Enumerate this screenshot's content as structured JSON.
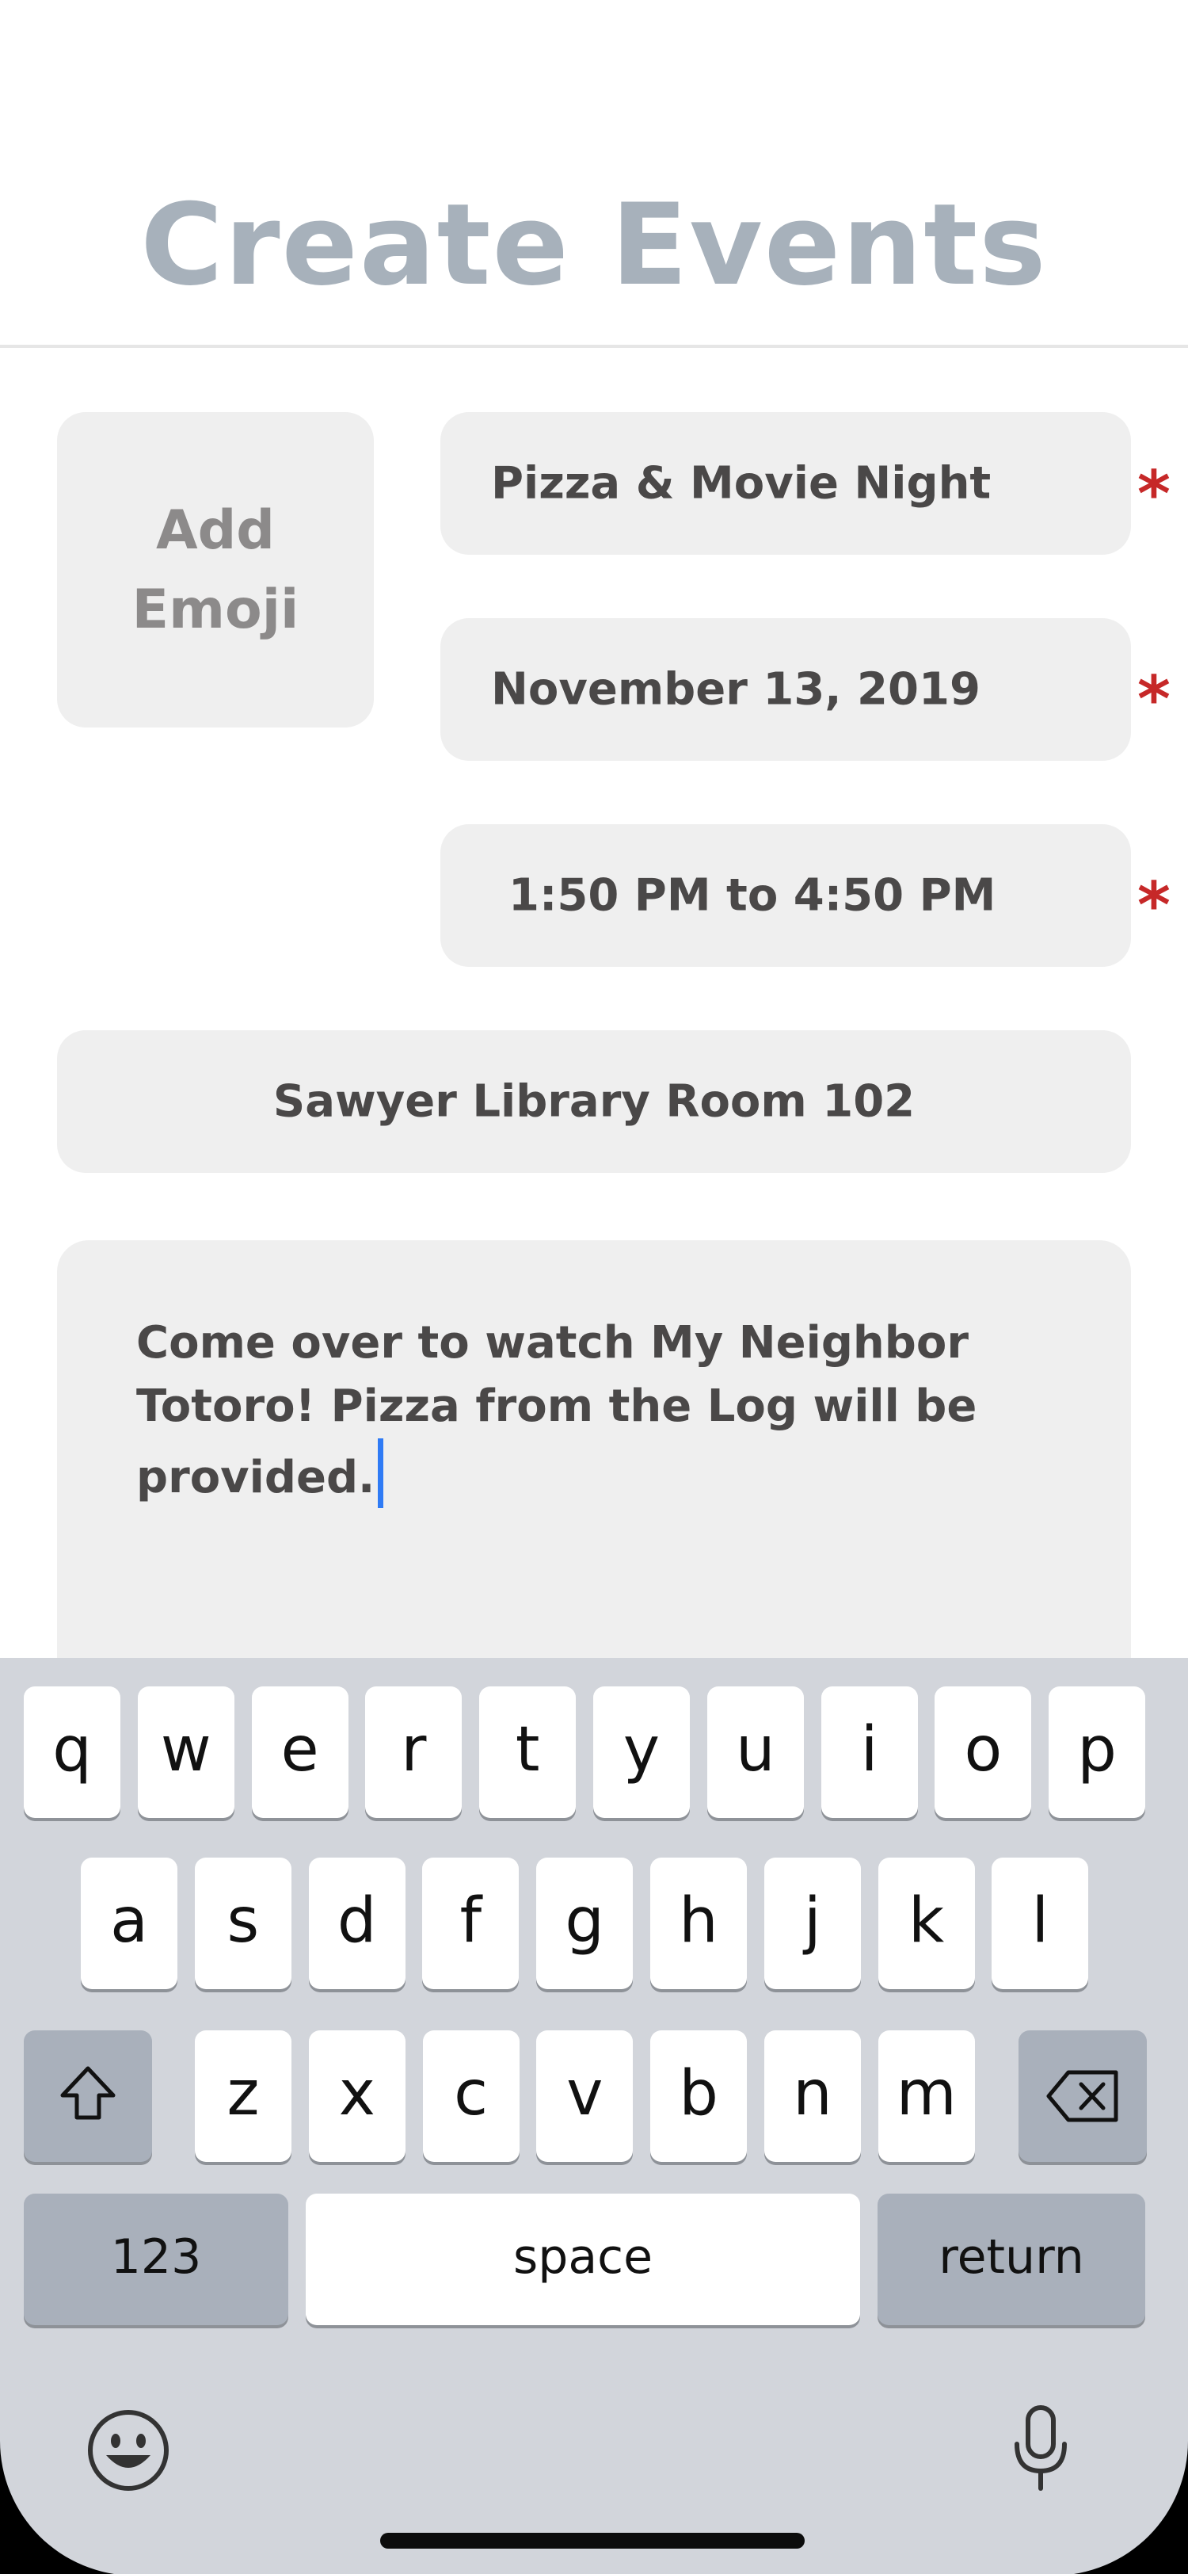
{
  "header": {
    "title": "Create Events"
  },
  "form": {
    "emoji_button_line1": "Add",
    "emoji_button_line2": "Emoji",
    "event_name": "Pizza & Movie Night",
    "date": "November 13, 2019",
    "time": "1:50 PM to 4:50 PM",
    "location": "Sawyer Library Room 102",
    "description_line1": "Come over to watch My Neighbor",
    "description_line2": "Totoro! Pizza from the Log will be",
    "description_line3": "provided.",
    "required_marker": "*"
  },
  "keyboard": {
    "row1": [
      "q",
      "w",
      "e",
      "r",
      "t",
      "y",
      "u",
      "i",
      "o",
      "p"
    ],
    "row2": [
      "a",
      "s",
      "d",
      "f",
      "g",
      "h",
      "j",
      "k",
      "l"
    ],
    "row3": [
      "z",
      "x",
      "c",
      "v",
      "b",
      "n",
      "m"
    ],
    "numbers_label": "123",
    "space_label": "space",
    "return_label": "return",
    "icons": {
      "shift": "shift-icon",
      "delete": "backspace-icon",
      "emoji": "emoji-icon",
      "dictation": "microphone-icon"
    }
  },
  "colors": {
    "title": "#a7b1bb",
    "field_bg": "#efefef",
    "required": "#c62828",
    "caret": "#2f7bf5",
    "keyboard_bg": "#d2d5db"
  }
}
